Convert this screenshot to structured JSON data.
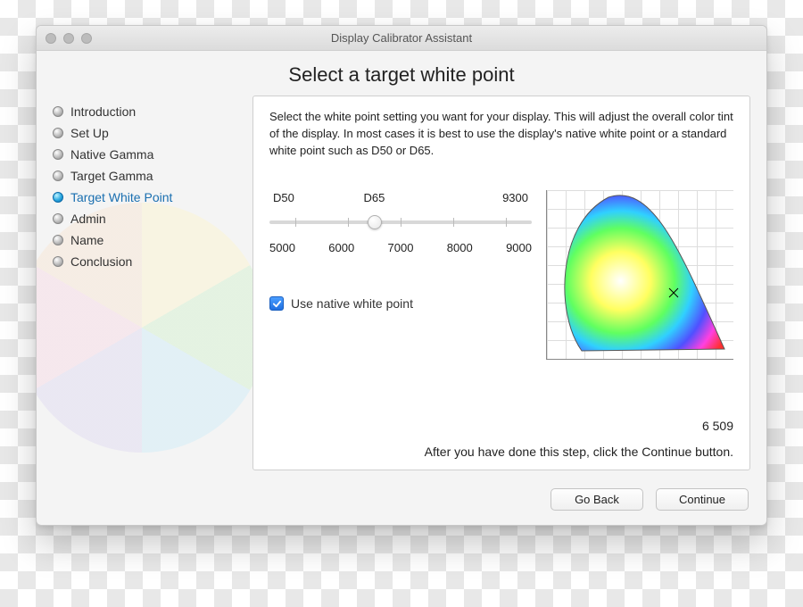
{
  "window": {
    "title": "Display Calibrator Assistant"
  },
  "heading": "Select a target white point",
  "steps": [
    {
      "label": "Introduction",
      "active": false
    },
    {
      "label": "Set Up",
      "active": false
    },
    {
      "label": "Native Gamma",
      "active": false
    },
    {
      "label": "Target Gamma",
      "active": false
    },
    {
      "label": "Target White Point",
      "active": true
    },
    {
      "label": "Admin",
      "active": false
    },
    {
      "label": "Name",
      "active": false
    },
    {
      "label": "Conclusion",
      "active": false
    }
  ],
  "content": {
    "description": "Select the white point setting you want for your display.  This will adjust the overall color tint of the display.  In most cases it is best to use the display's native white point or a standard white point such as D50 or D65.",
    "slider": {
      "preset_labels": [
        "D50",
        "D65",
        "9300"
      ],
      "tick_labels": [
        "5000",
        "6000",
        "7000",
        "8000",
        "9000"
      ],
      "min": 4500,
      "max": 9500,
      "value": 6509,
      "thumb_percent": 40
    },
    "checkbox": {
      "label": "Use native white point",
      "checked": true
    },
    "current_value_display": "6 509",
    "after_text": "After you have done this step, click the Continue button."
  },
  "footer": {
    "back_label": "Go Back",
    "continue_label": "Continue"
  }
}
